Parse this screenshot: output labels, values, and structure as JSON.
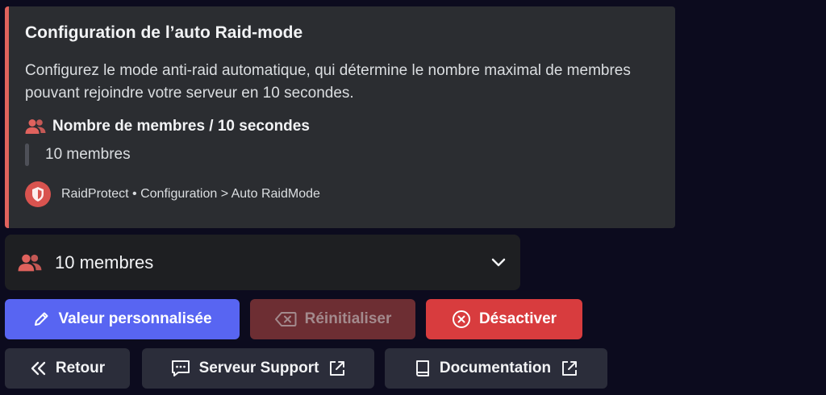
{
  "embed": {
    "accent_color": "#e0625d",
    "title": "Configuration de l’auto Raid-mode",
    "description": "Configurez le mode anti-raid automatique, qui détermine le nombre maximal de membres pouvant rejoindre votre serveur en 10 secondes.",
    "field": {
      "icon": "users-icon",
      "name": "Nombre de membres / 10 secondes",
      "value": "10 membres"
    },
    "footer": {
      "avatar_icon": "raidprotect-logo",
      "text": "RaidProtect • Configuration > Auto RaidMode"
    }
  },
  "select": {
    "icon": "users-icon",
    "value": "10 membres",
    "chevron": "chevron-down-icon"
  },
  "buttons": {
    "custom_value": {
      "label": "Valeur personnalisée",
      "icon": "pencil-icon",
      "color": "#5865f2"
    },
    "reset": {
      "label": "Réinitialiser",
      "icon": "backspace-icon",
      "color": "#6d2e33"
    },
    "disable": {
      "label": "Désactiver",
      "icon": "close-circle-icon",
      "color": "#d83c3e"
    },
    "back": {
      "label": "Retour",
      "icon": "double-chevron-left-icon"
    },
    "support": {
      "label": "Serveur Support",
      "icon": "chat-icon",
      "ext_icon": "external-link-icon"
    },
    "docs": {
      "label": "Documentation",
      "icon": "book-icon",
      "ext_icon": "external-link-icon"
    }
  }
}
